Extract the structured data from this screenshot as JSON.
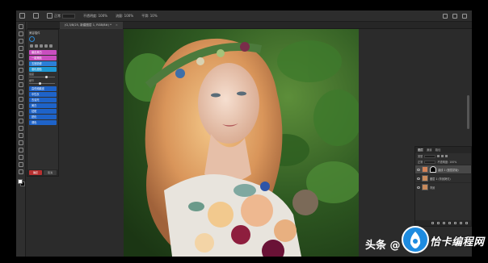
{
  "options_bar": {
    "mode_label": "正常",
    "opacity_label": "不透明度: 100%",
    "flow_label": "流量: 100%",
    "smoothing_label": "平滑: 10%"
  },
  "document_tab": {
    "title": "(G,3/8/25, 新建图层 1, RGB/8#) *",
    "close": "×"
  },
  "plugin_panel": {
    "title": "美容插件",
    "buttons": [
      {
        "label": "磨皮美白",
        "color": "pink"
      },
      {
        "label": "一键美颜",
        "color": "pink"
      },
      {
        "label": "五官精修",
        "color": "blue"
      },
      {
        "label": "液化瘦脸",
        "color": "cyan"
      }
    ],
    "sliders": [
      {
        "label": "强度"
      },
      {
        "label": "细节"
      }
    ],
    "list_buttons": [
      {
        "label": "高低频磨皮"
      },
      {
        "label": "中性灰"
      },
      {
        "label": "去油光"
      },
      {
        "label": "美白"
      },
      {
        "label": "祛斑"
      },
      {
        "label": "锐化"
      },
      {
        "label": "调色"
      }
    ],
    "footer": [
      "确定",
      "取消"
    ]
  },
  "layers_panel": {
    "tabs": [
      "图层",
      "通道",
      "路径"
    ],
    "filter_label": "类型",
    "blend_mode": "正常",
    "opacity": "不透明度: 100%",
    "layers": [
      {
        "name": "曲线 1 (图层蒙版)",
        "active": true,
        "mask": true
      },
      {
        "name": "图层 1 (背景拷贝)",
        "active": false,
        "mask": false
      },
      {
        "name": "背景",
        "active": false,
        "mask": false
      }
    ]
  },
  "watermark": {
    "prefix": "头条 @",
    "brand": "恰卡编程网"
  },
  "colors": {
    "ui_dark": "#2b2b2b",
    "accent_pink": "#c94ec0",
    "accent_blue": "#2b7fd8",
    "brand_blue": "#1d8be0"
  }
}
